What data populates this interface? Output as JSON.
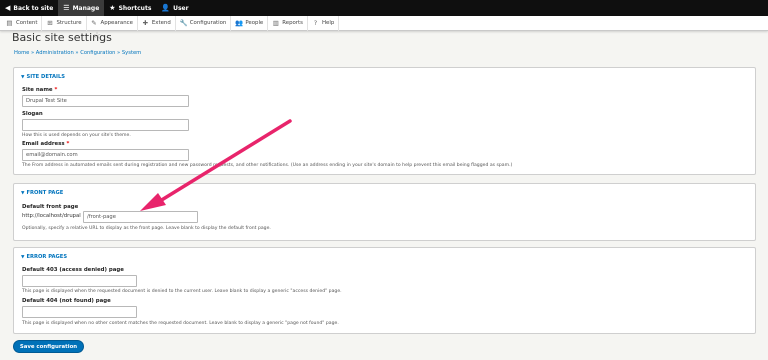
{
  "toolbar": {
    "back": "Back to site",
    "manage": "Manage",
    "shortcuts": "Shortcuts",
    "user": "User"
  },
  "menu": {
    "items": [
      "Content",
      "Structure",
      "Appearance",
      "Extend",
      "Configuration",
      "People",
      "Reports",
      "Help"
    ]
  },
  "page": {
    "title": "Basic site settings",
    "breadcrumb": "Home » Administration » Configuration » System"
  },
  "site_details": {
    "legend": "SITE DETAILS",
    "site_name_label": "Site name",
    "site_name_value": "Drupal Test Site",
    "slogan_label": "Slogan",
    "slogan_value": "",
    "slogan_desc": "How this is used depends on your site's theme.",
    "email_label": "Email address",
    "email_value": "email@domain.com",
    "email_desc": "The From address in automated emails sent during registration and new password requests, and other notifications. (Use an address ending in your site's domain to help prevent this email being flagged as spam.)"
  },
  "front_page": {
    "legend": "FRONT PAGE",
    "label": "Default front page",
    "prefix": "http://localhost/drupal",
    "value": "/front-page",
    "desc": "Optionally, specify a relative URL to display as the front page. Leave blank to display the default front page."
  },
  "error_pages": {
    "legend": "ERROR PAGES",
    "p403_label": "Default 403 (access denied) page",
    "p403_value": "",
    "p403_desc": "This page is displayed when the requested document is denied to the current user. Leave blank to display a generic \"access denied\" page.",
    "p404_label": "Default 404 (not found) page",
    "p404_value": "",
    "p404_desc": "This page is displayed when no other content matches the requested document. Leave blank to display a generic \"page not found\" page."
  },
  "actions": {
    "save": "Save configuration"
  },
  "colors": {
    "link": "#0074bd",
    "button": "#0071b8",
    "arrow": "#e8246b"
  }
}
